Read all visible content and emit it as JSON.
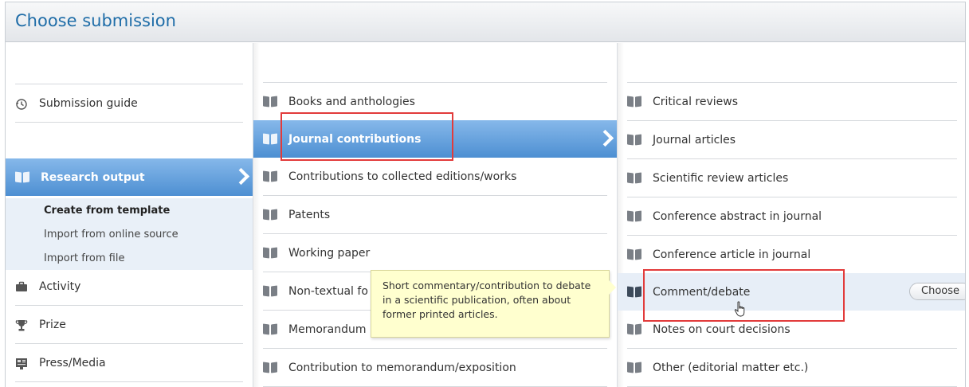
{
  "window": {
    "title": "Choose submission"
  },
  "column1": {
    "submission_guide": {
      "label": "Submission guide",
      "icon": "history-icon"
    },
    "research_output": {
      "label": "Research output",
      "icon": "book-icon"
    },
    "sub_items": [
      "Create from template",
      "Import from online source",
      "Import from file"
    ],
    "activity": {
      "label": "Activity",
      "icon": "briefcase-icon"
    },
    "prize": {
      "label": "Prize",
      "icon": "trophy-icon"
    },
    "press_media": {
      "label": "Press/Media",
      "icon": "media-icon"
    }
  },
  "column2": {
    "items": [
      "Books and anthologies",
      "Journal contributions",
      "Contributions to collected editions/works",
      "Patents",
      "Working paper",
      "Non-textual fo",
      "Memorandum",
      "Contribution to memorandum/exposition"
    ]
  },
  "column3": {
    "items": [
      "Critical reviews",
      "Journal articles",
      "Scientific review articles",
      "Conference abstract in journal",
      "Conference article in journal",
      "Comment/debate",
      "Notes on court decisions",
      "Other (editorial matter etc.)"
    ],
    "choose_label": "Choose"
  },
  "tooltip": {
    "text": "Short commentary/contribution to debate in a scientific publication, often about former printed articles."
  },
  "colors": {
    "accent": "#4d8fd2",
    "title": "#1f6da8",
    "highlight": "#e23b3b",
    "tooltip_bg": "#ffffcf"
  }
}
